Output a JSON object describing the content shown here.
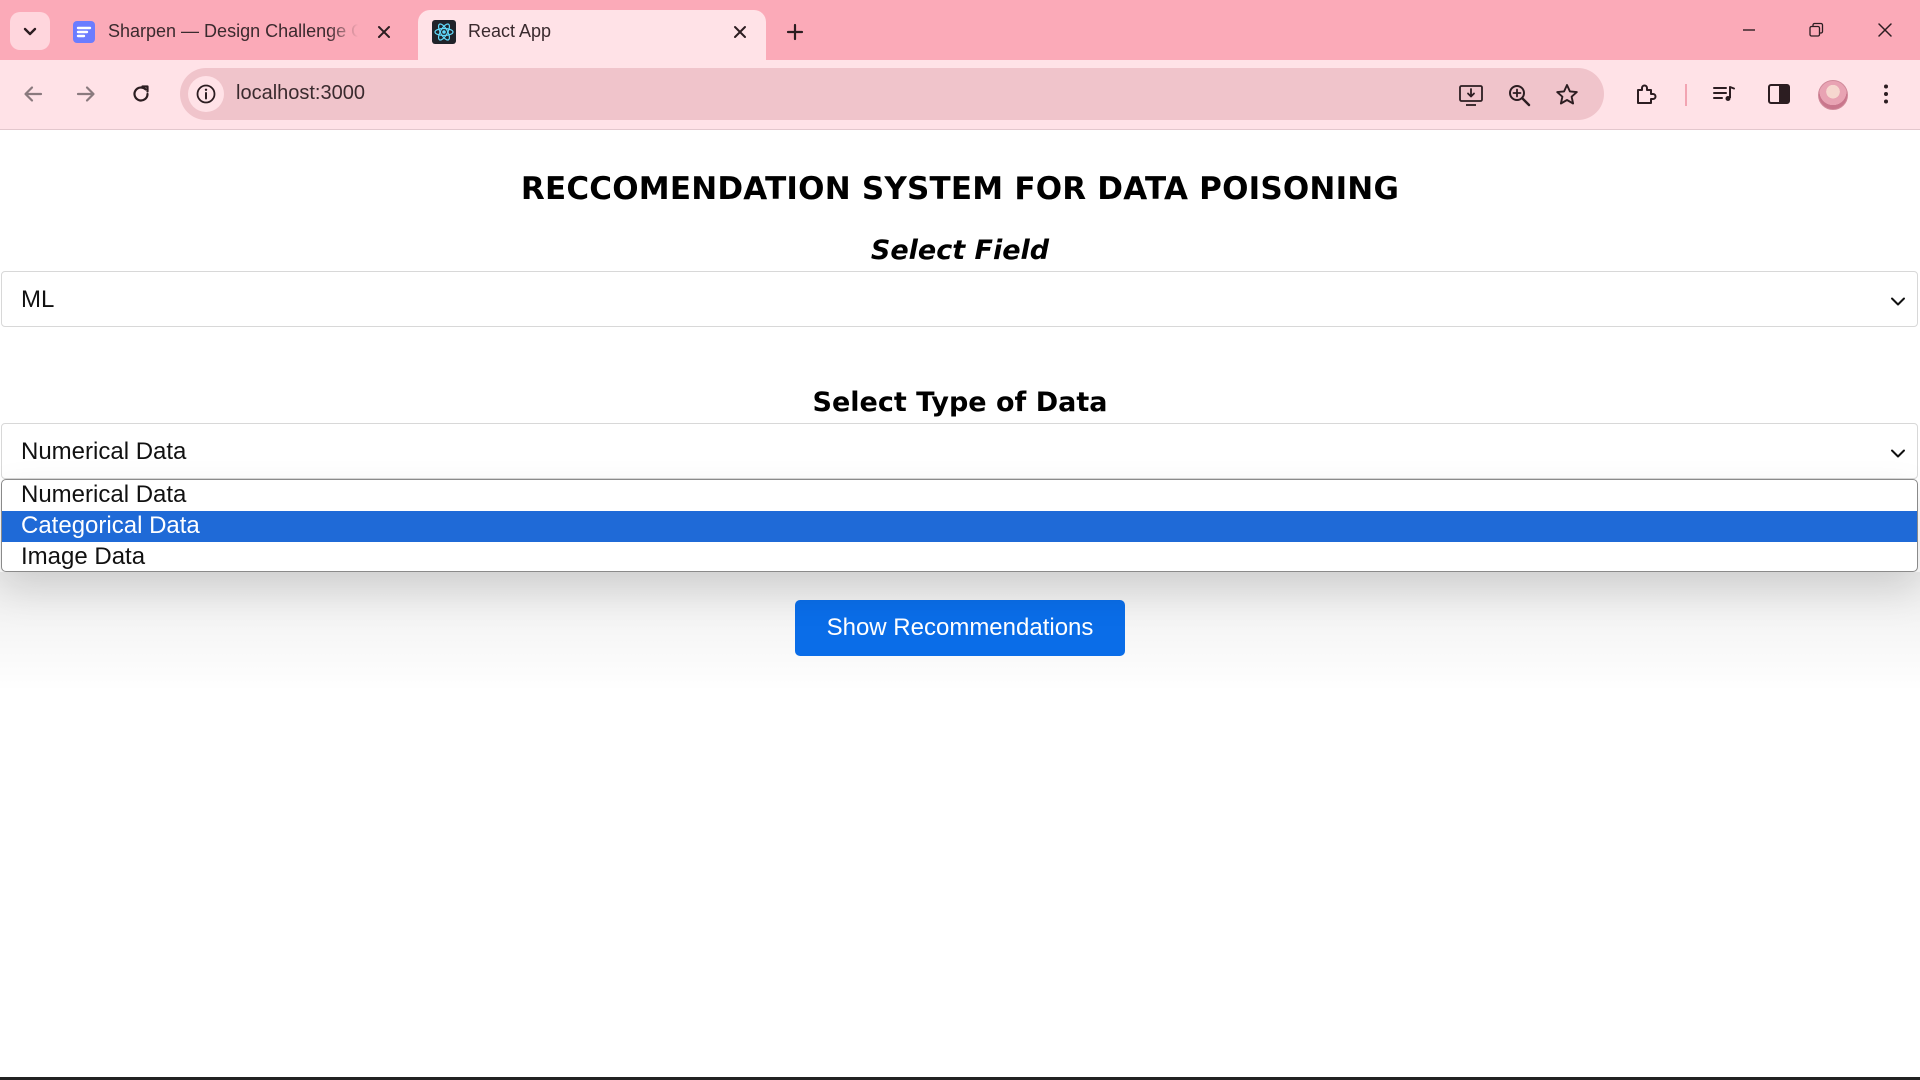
{
  "browser": {
    "tabs": [
      {
        "title": "Sharpen — Design Challenge Generator",
        "favicon": "sharpen-logo-icon",
        "active": false
      },
      {
        "title": "React App",
        "favicon": "react-logo-icon",
        "active": true
      }
    ],
    "address": {
      "url": "localhost:3000"
    },
    "colors": {
      "tabstrip": "#fbaab8",
      "toolbar": "#ffe2e7",
      "omnibox": "#f0c4cb"
    }
  },
  "page": {
    "title": "RECCOMENDATION SYSTEM FOR DATA POISONING",
    "field_label": "Select Field",
    "field_select": {
      "value": "ML"
    },
    "type_label": "Select Type of Data",
    "type_select": {
      "value": "Numerical Data",
      "options": [
        "Numerical Data",
        "Categorical Data",
        "Image Data"
      ],
      "highlighted": "Categorical Data"
    },
    "button_label": "Show Recommendations",
    "colors": {
      "button": "#0a6de8",
      "highlight": "#1f6ad7"
    }
  }
}
